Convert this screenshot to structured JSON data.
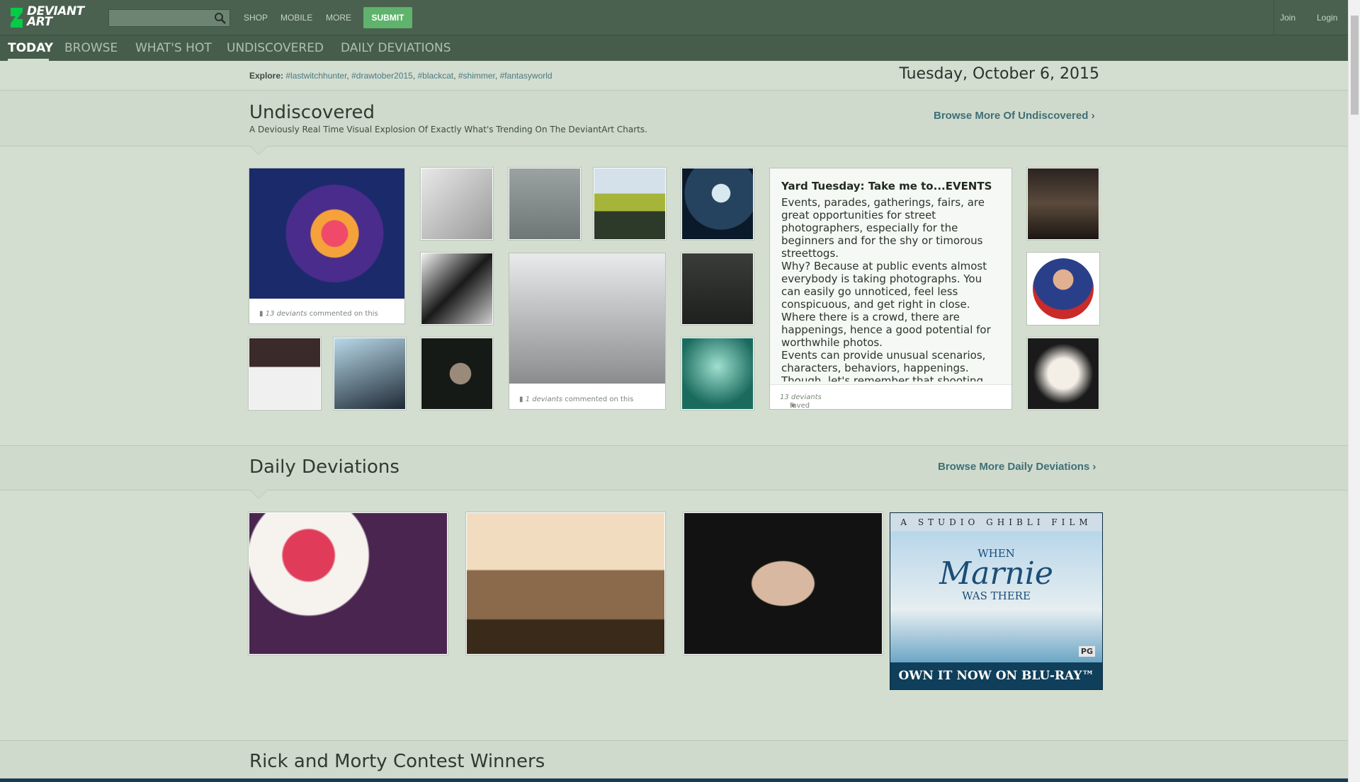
{
  "header": {
    "logo_line1": "DEVIANT",
    "logo_line2": "ART",
    "search_placeholder": "",
    "nav": [
      "SHOP",
      "MOBILE",
      "MORE"
    ],
    "submit_label": "SUBMIT",
    "join_label": "Join",
    "login_label": "Login"
  },
  "tabs": [
    "TODAY",
    "BROWSE",
    "WHAT'S HOT",
    "UNDISCOVERED",
    "DAILY DEVIATIONS"
  ],
  "explore": {
    "label": "Explore:",
    "tags": [
      "#lastwitchhunter",
      "#drawtober2015",
      "#blackcat",
      "#shimmer",
      "#fantasyworld"
    ]
  },
  "date": "Tuesday, October 6, 2015",
  "undiscovered": {
    "title": "Undiscovered",
    "subtitle": "A Deviously Real Time Visual Explosion Of Exactly What's Trending On The DeviantArt Charts.",
    "browse_label": "Browse More Of Undiscovered",
    "card1_count": "13 deviants",
    "card1_suffix": "commented on this",
    "card2_count": "1 deviants",
    "card2_suffix": "commented on this"
  },
  "journal": {
    "title": "Yard Tuesday: Take me to...EVENTS",
    "para1": "Events, parades, gatherings, fairs, are great opportunities for street photographers, especially for the beginners and for the shy or timorous streettogs.",
    "para2": "Why? Because at public events almost everybody is taking photographs. You can easily go unnoticed, feel less conspicuous, and get right in close. Where there is a crowd, there are happenings, hence a good potential for worthwhile photos.",
    "para3": "Events can provide unusual scenarios, characters, behaviors, happenings. Though, let's remember that shooting",
    "fave_count": "13 deviants",
    "fave_suffix": "faved this"
  },
  "daily": {
    "title": "Daily Deviations",
    "browse_label": "Browse More Daily Deviations"
  },
  "ad": {
    "top_line": "A STUDIO GHIBLI FILM",
    "line1": "WHEN",
    "line2": "Marnie",
    "line3": "WAS THERE",
    "rating": "PG",
    "cta": "OWN IT NOW ON BLU-RAY™"
  },
  "next_section": {
    "title": "Rick and Morty Contest Winners"
  }
}
